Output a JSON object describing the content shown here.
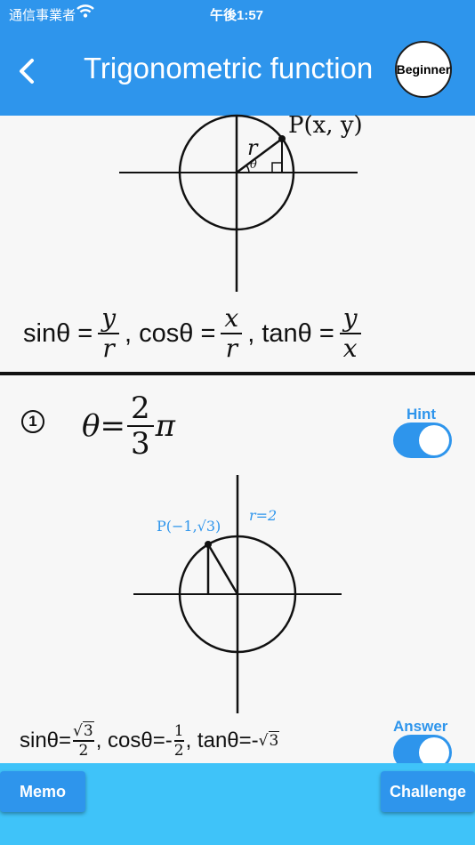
{
  "status": {
    "carrier": "通信事業者",
    "time": "午後1:57"
  },
  "header": {
    "title": "Trigonometric function",
    "badge": "Beginner"
  },
  "intro": {
    "point_label": "P(x, y)",
    "radius_label": "r",
    "angle_label": "θ",
    "sin_label": "sinθ =",
    "cos_label": ", cosθ =",
    "tan_label": ", tanθ =",
    "sin_num": "y",
    "sin_den": "r",
    "cos_num": "x",
    "cos_den": "r",
    "tan_num": "y",
    "tan_den": "x"
  },
  "question": {
    "number": "1",
    "theta_prefix": "θ=",
    "frac_num": "2",
    "frac_den": "3",
    "pi": "π",
    "hint_label": "Hint",
    "hint_on": true,
    "diagram_point_label": "P(−1,√3)",
    "diagram_radius_label": "r=2",
    "answer_label": "Answer",
    "answer_on": true,
    "answer": {
      "sin_prefix": "sinθ=",
      "sin_num": "3",
      "sin_den": "2",
      "cos_prefix": ", cosθ=-",
      "cos_num": "1",
      "cos_den": "2",
      "tan_prefix": ", tanθ=-",
      "tan_rad": "3"
    }
  },
  "footer": {
    "memo_label": "Memo",
    "challenge_label": "Challenge"
  },
  "colors": {
    "header": "#2e95ec",
    "footer": "#3fc3f9",
    "accent": "#2e95ec"
  }
}
